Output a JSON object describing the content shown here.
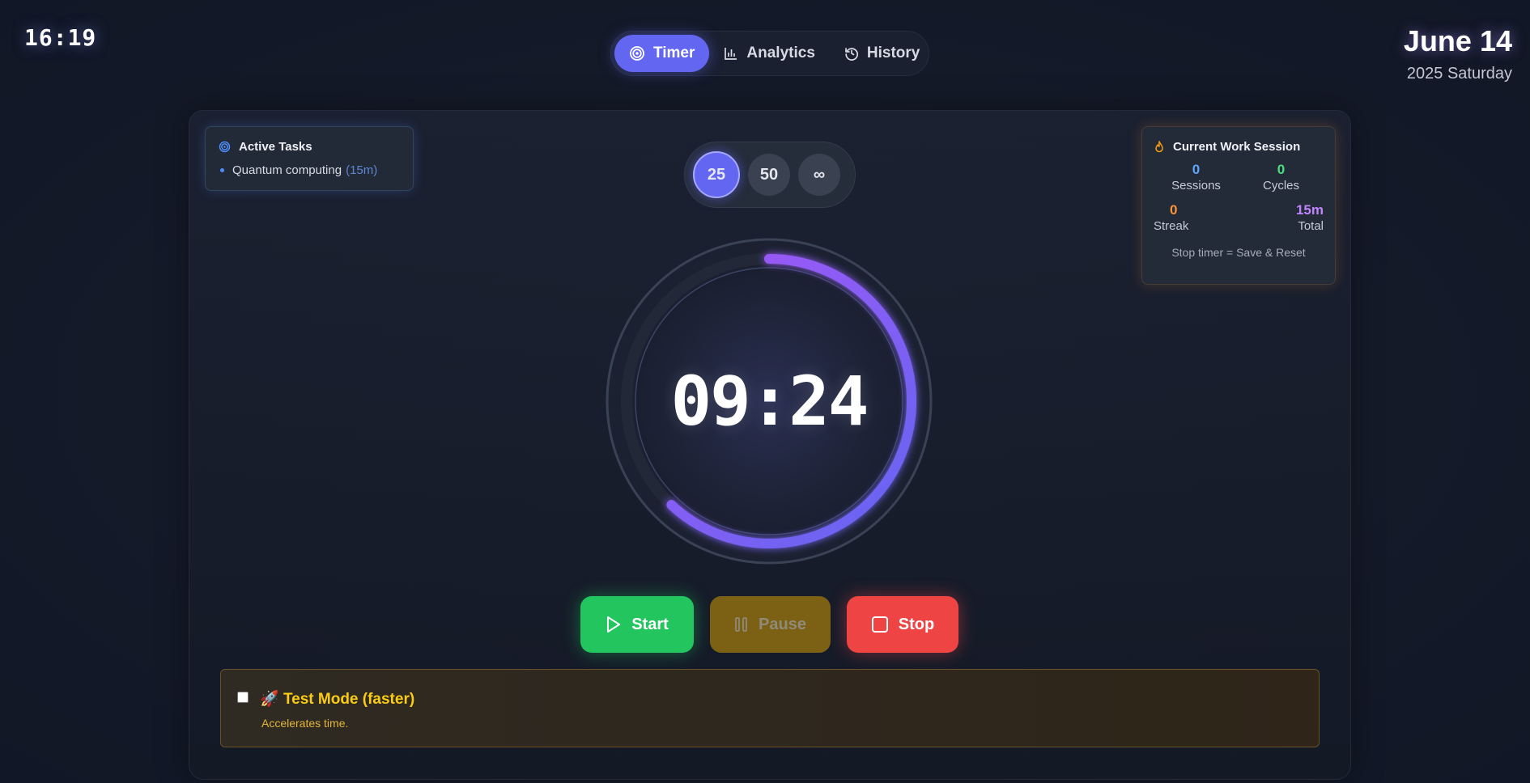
{
  "clock": {
    "time": "16:19"
  },
  "date": {
    "main": "June 14",
    "sub": "2025 Saturday"
  },
  "nav": {
    "tabs": [
      {
        "label": "Timer",
        "icon": "target-icon",
        "active": true
      },
      {
        "label": "Analytics",
        "icon": "bar-chart-icon",
        "active": false
      },
      {
        "label": "History",
        "icon": "history-icon",
        "active": false
      }
    ]
  },
  "active_tasks": {
    "title": "Active Tasks",
    "items": [
      {
        "name": "Quantum computing",
        "duration": "(15m)"
      }
    ]
  },
  "presets": {
    "options": [
      "25",
      "50",
      "∞"
    ],
    "selected": "25"
  },
  "timer": {
    "display": "09:24",
    "progress": 0.62,
    "colors": {
      "ring_start": "#6366f1",
      "ring_end": "#a855f7",
      "track": "#222838"
    }
  },
  "controls": {
    "start_label": "Start",
    "pause_label": "Pause",
    "stop_label": "Stop"
  },
  "session": {
    "title": "Current Work Session",
    "stats": [
      {
        "value": "0",
        "label": "Sessions",
        "color": "#60a5fa"
      },
      {
        "value": "0",
        "label": "Cycles",
        "color": "#4ade80"
      },
      {
        "value": "0",
        "label": "Streak",
        "color": "#fb923c"
      },
      {
        "value": "15m",
        "label": "Total",
        "color": "#c084fc"
      }
    ],
    "note": "Stop timer = Save & Reset"
  },
  "test_mode": {
    "checked": false,
    "emoji": "🚀",
    "label": "Test Mode (faster)",
    "description": "Accelerates time."
  }
}
